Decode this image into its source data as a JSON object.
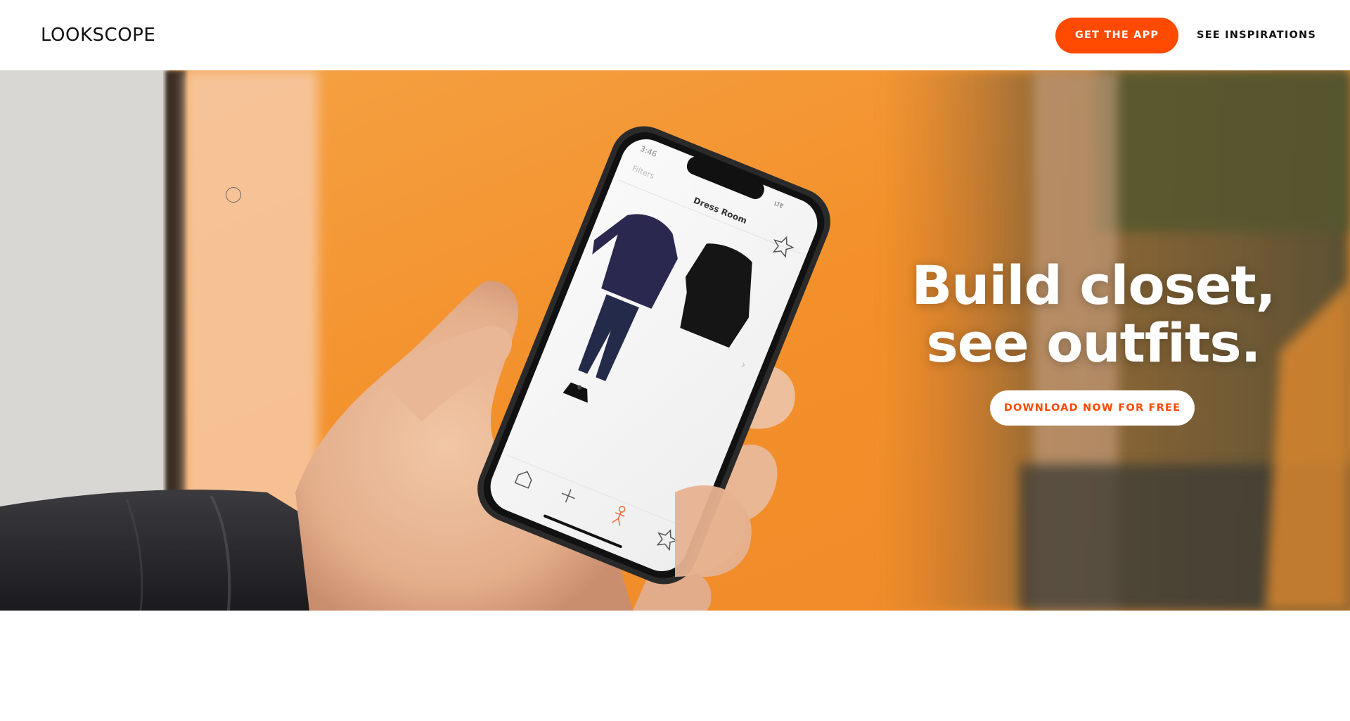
{
  "header": {
    "logo": "LOOKSCOPE",
    "get_app_label": "GET THE APP",
    "inspirations_label": "SEE INSPIRATIONS"
  },
  "hero": {
    "headline_line1": "Build closet,",
    "headline_line2": "see outfits.",
    "cta_label": "DOWNLOAD NOW FOR FREE"
  },
  "phone_screen": {
    "time": "3:46",
    "network": "LTE",
    "filters_label": "Filters",
    "title": "Dress Room",
    "tab_icons": [
      "home-icon",
      "add-icon",
      "person-icon",
      "star-icon"
    ]
  },
  "colors": {
    "accent": "#ff4a00",
    "hero_orange": "#f39a2b",
    "white": "#ffffff"
  }
}
